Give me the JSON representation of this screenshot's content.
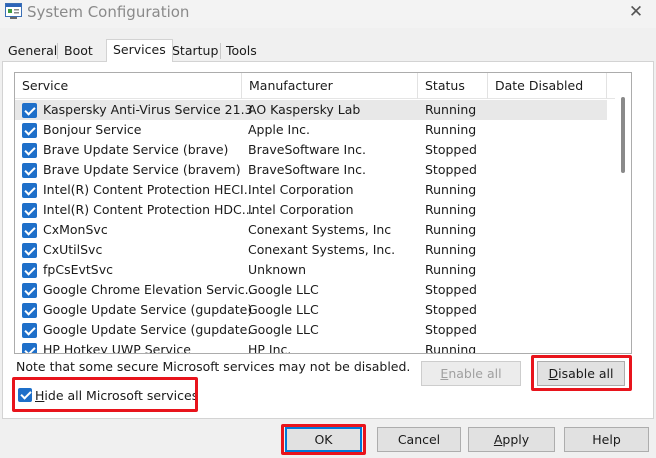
{
  "window": {
    "title": "System Configuration",
    "close_glyph": "✕",
    "icon": "msconfig-icon"
  },
  "tabs": [
    {
      "label": "General"
    },
    {
      "label": "Boot"
    },
    {
      "label": "Services",
      "active": true
    },
    {
      "label": "Startup"
    },
    {
      "label": "Tools"
    }
  ],
  "columns": [
    "Service",
    "Manufacturer",
    "Status",
    "Date Disabled"
  ],
  "services": [
    {
      "name": "Kaspersky Anti-Virus Service 21.3",
      "manufacturer": "AO Kaspersky Lab",
      "status": "Running",
      "checked": true
    },
    {
      "name": "Bonjour Service",
      "manufacturer": "Apple Inc.",
      "status": "Running",
      "checked": true
    },
    {
      "name": "Brave Update Service (brave)",
      "manufacturer": "BraveSoftware Inc.",
      "status": "Stopped",
      "checked": true
    },
    {
      "name": "Brave Update Service (bravem)",
      "manufacturer": "BraveSoftware Inc.",
      "status": "Stopped",
      "checked": true
    },
    {
      "name": "Intel(R) Content Protection HECI...",
      "manufacturer": "Intel Corporation",
      "status": "Running",
      "checked": true
    },
    {
      "name": "Intel(R) Content Protection HDC...",
      "manufacturer": "Intel Corporation",
      "status": "Running",
      "checked": true
    },
    {
      "name": "CxMonSvc",
      "manufacturer": "Conexant Systems, Inc",
      "status": "Running",
      "checked": true
    },
    {
      "name": "CxUtilSvc",
      "manufacturer": "Conexant Systems, Inc.",
      "status": "Running",
      "checked": true
    },
    {
      "name": "fpCsEvtSvc",
      "manufacturer": "Unknown",
      "status": "Running",
      "checked": true
    },
    {
      "name": "Google Chrome Elevation Servic...",
      "manufacturer": "Google LLC",
      "status": "Stopped",
      "checked": true
    },
    {
      "name": "Google Update Service (gupdate)",
      "manufacturer": "Google LLC",
      "status": "Stopped",
      "checked": true
    },
    {
      "name": "Google Update Service (gupdate...",
      "manufacturer": "Google LLC",
      "status": "Stopped",
      "checked": true
    },
    {
      "name": "HP Hotkey UWP Service",
      "manufacturer": "HP Inc.",
      "status": "Running",
      "checked": true
    }
  ],
  "note": "Note that some secure Microsoft services may not be disabled.",
  "buttons": {
    "enable_all": {
      "prefix": "",
      "accel": "E",
      "rest": "nable all"
    },
    "disable_all": {
      "prefix": "",
      "accel": "D",
      "rest": "isable all"
    },
    "ok": "OK",
    "cancel": "Cancel",
    "apply": {
      "prefix": "",
      "accel": "A",
      "rest": "pply"
    },
    "help": "Help"
  },
  "hide_ms": {
    "prefix": "",
    "accel": "H",
    "rest": "ide all Microsoft services",
    "checked": true
  },
  "colors": {
    "highlight": "#e8141c",
    "checkbox": "#1e6fc9",
    "selected_row": "#e8e8e8"
  }
}
